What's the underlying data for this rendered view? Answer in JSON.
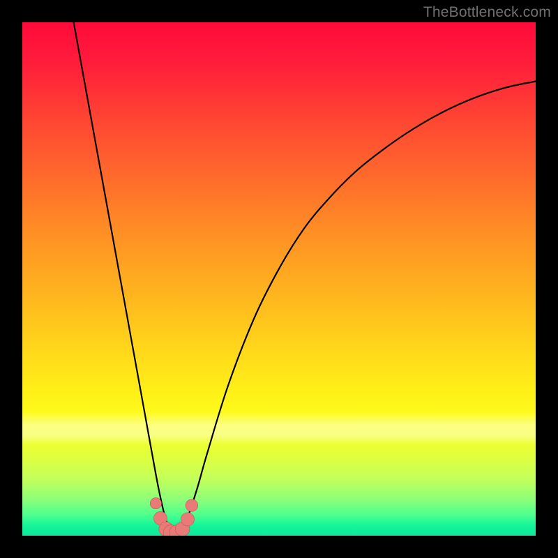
{
  "watermark": "TheBottleneck.com",
  "colors": {
    "frame": "#000000",
    "curve": "#000000",
    "marker_fill": "#e87a78",
    "marker_stroke": "#c55753",
    "gradient_top": "#ff0a3a",
    "gradient_bottom": "#0ee89c"
  },
  "chart_data": {
    "type": "line",
    "title": "",
    "xlabel": "",
    "ylabel": "",
    "xlim": [
      0,
      100
    ],
    "ylim": [
      0,
      100
    ],
    "grid": false,
    "legend": false,
    "series": [
      {
        "name": "bottleneck-curve",
        "x": [
          10,
          12,
          14,
          16,
          18,
          20,
          22,
          24,
          26,
          27,
          28,
          29,
          30,
          31,
          32,
          34,
          36,
          40,
          45,
          50,
          55,
          60,
          65,
          70,
          75,
          80,
          85,
          90,
          95,
          100
        ],
        "y": [
          100,
          89,
          78,
          67,
          56,
          45,
          34,
          23,
          12,
          7,
          3,
          1,
          0.5,
          1,
          3,
          9,
          16,
          29,
          42,
          52,
          60,
          66,
          71,
          75,
          78.5,
          81.5,
          84,
          86,
          87.5,
          88.5
        ]
      }
    ],
    "markers": [
      {
        "x": 26.0,
        "y": 6.3,
        "r": 1.1
      },
      {
        "x": 26.9,
        "y": 3.4,
        "r": 1.3
      },
      {
        "x": 28.0,
        "y": 1.3,
        "r": 1.4
      },
      {
        "x": 29.0,
        "y": 0.6,
        "r": 1.5
      },
      {
        "x": 30.1,
        "y": 0.6,
        "r": 1.5
      },
      {
        "x": 31.2,
        "y": 1.3,
        "r": 1.4
      },
      {
        "x": 32.2,
        "y": 3.2,
        "r": 1.3
      },
      {
        "x": 33.0,
        "y": 5.9,
        "r": 1.2
      }
    ]
  }
}
